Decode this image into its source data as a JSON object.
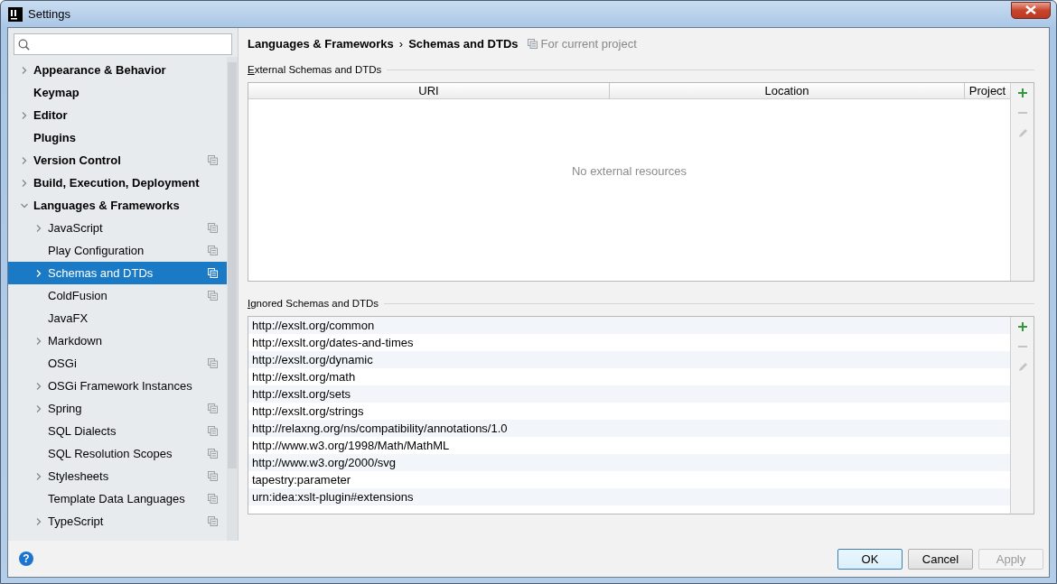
{
  "window": {
    "title": "Settings"
  },
  "sidebar": {
    "items": [
      {
        "label": "Appearance & Behavior",
        "expanded": false,
        "selected": false,
        "project_scoped": false
      },
      {
        "label": "Keymap",
        "selected": false,
        "project_scoped": false
      },
      {
        "label": "Editor",
        "expanded": false,
        "selected": false,
        "project_scoped": false
      },
      {
        "label": "Plugins",
        "selected": false,
        "project_scoped": false
      },
      {
        "label": "Version Control",
        "expanded": false,
        "selected": false,
        "project_scoped": true
      },
      {
        "label": "Build, Execution, Deployment",
        "expanded": false,
        "selected": false,
        "project_scoped": false
      },
      {
        "label": "Languages & Frameworks",
        "expanded": true,
        "selected": false,
        "project_scoped": false,
        "children": [
          {
            "label": "JavaScript",
            "expanded": false,
            "selected": false,
            "project_scoped": true
          },
          {
            "label": "Play Configuration",
            "selected": false,
            "project_scoped": true
          },
          {
            "label": "Schemas and DTDs",
            "expanded": false,
            "selected": true,
            "project_scoped": true
          },
          {
            "label": "ColdFusion",
            "selected": false,
            "project_scoped": true
          },
          {
            "label": "JavaFX",
            "selected": false,
            "project_scoped": false
          },
          {
            "label": "Markdown",
            "expanded": false,
            "selected": false,
            "project_scoped": false
          },
          {
            "label": "OSGi",
            "selected": false,
            "project_scoped": true
          },
          {
            "label": "OSGi Framework Instances",
            "expanded": false,
            "selected": false,
            "project_scoped": false
          },
          {
            "label": "Spring",
            "expanded": false,
            "selected": false,
            "project_scoped": true
          },
          {
            "label": "SQL Dialects",
            "selected": false,
            "project_scoped": true
          },
          {
            "label": "SQL Resolution Scopes",
            "selected": false,
            "project_scoped": true
          },
          {
            "label": "Stylesheets",
            "expanded": false,
            "selected": false,
            "project_scoped": true
          },
          {
            "label": "Template Data Languages",
            "selected": false,
            "project_scoped": true
          },
          {
            "label": "TypeScript",
            "expanded": false,
            "selected": false,
            "project_scoped": true
          }
        ]
      }
    ]
  },
  "breadcrumb": {
    "items": [
      "Languages & Frameworks",
      "Schemas and DTDs"
    ],
    "separator": "›",
    "scope": "For current project"
  },
  "external": {
    "title": "External Schemas and DTDs",
    "columns": [
      "URI",
      "Location",
      "Project"
    ],
    "empty_text": "No external resources",
    "toolbar": [
      {
        "kind": "add",
        "disabled": false
      },
      {
        "kind": "remove",
        "disabled": true
      },
      {
        "kind": "edit",
        "disabled": true
      }
    ]
  },
  "ignored": {
    "title": "Ignored Schemas and DTDs",
    "rows": [
      "http://exslt.org/common",
      "http://exslt.org/dates-and-times",
      "http://exslt.org/dynamic",
      "http://exslt.org/math",
      "http://exslt.org/sets",
      "http://exslt.org/strings",
      "http://relaxng.org/ns/compatibility/annotations/1.0",
      "http://www.w3.org/1998/Math/MathML",
      "http://www.w3.org/2000/svg",
      "tapestry:parameter",
      "urn:idea:xslt-plugin#extensions"
    ],
    "toolbar": [
      {
        "kind": "add",
        "disabled": false
      },
      {
        "kind": "remove",
        "disabled": true
      },
      {
        "kind": "edit",
        "disabled": true
      }
    ]
  },
  "footer": {
    "help": "?",
    "buttons": [
      {
        "label": "OK",
        "default": true,
        "disabled": false
      },
      {
        "label": "Cancel",
        "default": false,
        "disabled": false
      },
      {
        "label": "Apply",
        "default": false,
        "disabled": true
      }
    ]
  }
}
